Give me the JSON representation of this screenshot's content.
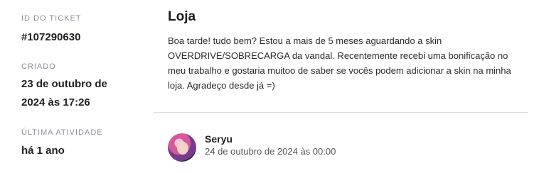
{
  "sidebar": {
    "ticket_id_label": "ID DO TICKET",
    "ticket_id": "#107290630",
    "created_label": "CRIADO",
    "created_value": "23 de outubro de 2024 às 17:26",
    "last_activity_label": "ÚLTIMA ATIVIDADE",
    "last_activity_value": "há 1 ano"
  },
  "ticket": {
    "title": "Loja",
    "body": "Boa tarde! tudo bem? Estou a mais de 5 meses aguardando a skin OVERDRIVE/SOBRECARGA da vandal. Recentemente recebi uma bonificação no meu trabalho e gostaria muitoo de saber se vocês podem adicionar a skin na minha loja. Agradeço desde já =)"
  },
  "author": {
    "name": "Seryu",
    "date": "24 de outubro de 2024 às 00:00"
  }
}
